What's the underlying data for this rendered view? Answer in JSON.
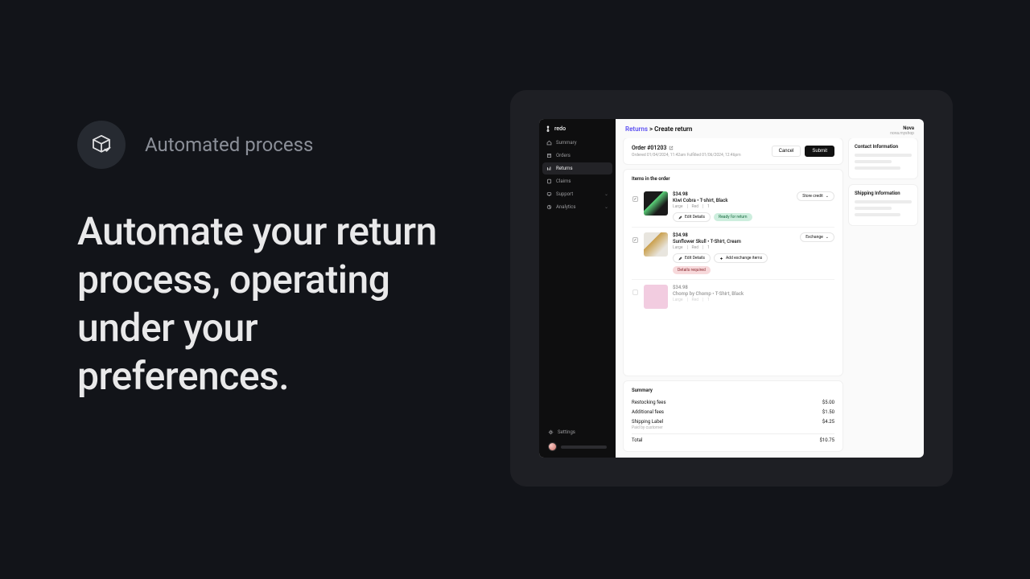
{
  "marketing": {
    "pill_label": "Automated process",
    "headline": "Automate your return process, operating under your preferences."
  },
  "app": {
    "logo": "redo",
    "sidebar": {
      "items": [
        {
          "label": "Summary",
          "icon": "home"
        },
        {
          "label": "Orders",
          "icon": "orders"
        },
        {
          "label": "Returns",
          "icon": "returns",
          "active": true
        },
        {
          "label": "Claims",
          "icon": "claims"
        },
        {
          "label": "Support",
          "icon": "support",
          "expandable": true
        },
        {
          "label": "Analytics",
          "icon": "analytics",
          "expandable": true
        }
      ],
      "settings": "Settings"
    },
    "tenant": {
      "name": "Nova",
      "url": "nova.myshop"
    },
    "breadcrumb": {
      "link": "Returns",
      "separator": ">",
      "current": "Create return"
    },
    "order_header": {
      "id": "Order #01203",
      "meta": "Ordered 01/04/2024, 11:42am    Fulfilled 01/06/2024, 12:46pm",
      "cancel": "Cancel",
      "submit": "Submit"
    },
    "items_section": {
      "title": "Items in the order",
      "items": [
        {
          "checked": true,
          "price": "$34.98",
          "name": "Kiwi Cobra • T-shirt, Black",
          "size": "Large",
          "color": "Red",
          "qty": "1",
          "edit": "Edit Details",
          "status": "Ready for return",
          "status_kind": "green",
          "dropdown": "Store credit"
        },
        {
          "checked": true,
          "price": "$34.98",
          "name": "Sunflower Skull • T-Shirt, Cream",
          "size": "Large",
          "color": "Red",
          "qty": "1",
          "edit": "Edit Details",
          "exchange": "Add exchange items",
          "status": "Details required",
          "status_kind": "pink",
          "dropdown": "Exchange"
        },
        {
          "checked": false,
          "price": "$34.98",
          "name": "Chomp by Chomp • T-Shirt, Black",
          "size": "Large",
          "color": "Red",
          "qty": "1"
        }
      ]
    },
    "summary": {
      "title": "Summary",
      "rows": [
        {
          "label": "Restocking fees",
          "value": "$5.00"
        },
        {
          "label": "Additional fees",
          "value": "$1.50"
        },
        {
          "label": "Shipping Label",
          "value": "$4.25",
          "note": "Paid by customer"
        }
      ],
      "total_label": "Total",
      "total_value": "$10.75"
    },
    "right": {
      "contact_title": "Contact Information",
      "shipping_title": "Shipping Information"
    }
  }
}
